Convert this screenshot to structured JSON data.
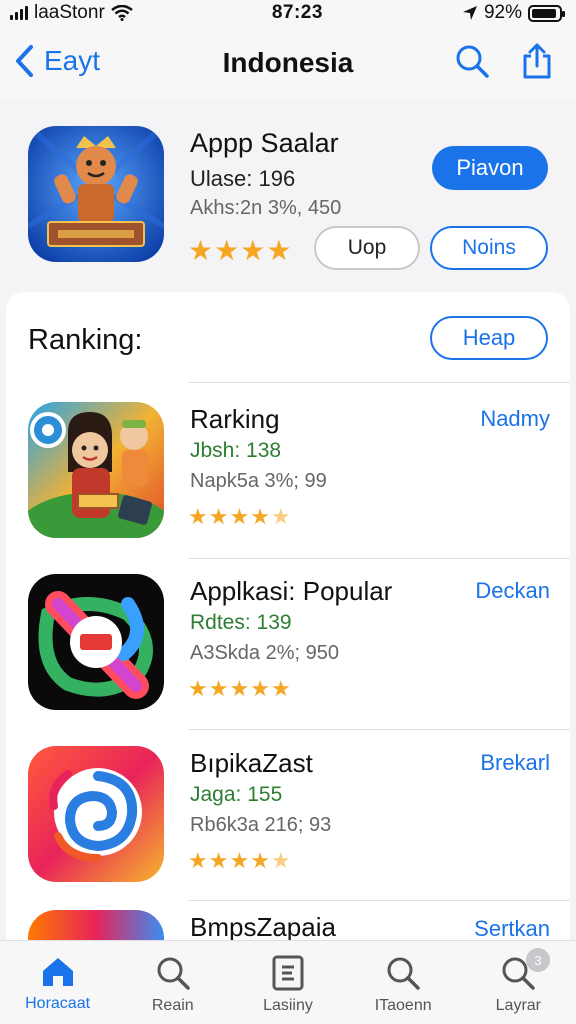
{
  "status_bar": {
    "carrier": "laaStonr",
    "time": "87:23",
    "battery_pct": "92%",
    "battery_level": 0.92
  },
  "nav": {
    "back_label": "Eayt",
    "title": "Indonesia",
    "icons": [
      "search-icon",
      "share-icon"
    ]
  },
  "featured": {
    "name": "Appp Saalar",
    "sub1": "Ulase: 196",
    "sub2": "Akhs:2n 3%, 450",
    "rating": 4,
    "primary_button": "Piavon",
    "button_left": "Uop",
    "button_right": "Noins"
  },
  "ranking": {
    "title": "Ranking:",
    "button": "Heap",
    "items": [
      {
        "name": "Rarking",
        "sub1": "Jbsh: 138",
        "sub2": "Napk5a 3%; 99",
        "rating": 4.5,
        "action": "Nadmy",
        "icon": "game-character-icon"
      },
      {
        "name": "Applkasi: Popular",
        "sub1": "Rdtes: 139",
        "sub2": "A3Skda 2%; 950",
        "rating": 5,
        "action": "Deckan",
        "icon": "neon-app-icon"
      },
      {
        "name": "BıpikaZast",
        "sub1": "Jaga: 155",
        "sub2": "Rb6k3a 216; 93",
        "rating": 4.5,
        "action": "Brekarl",
        "icon": "swirl-app-icon"
      },
      {
        "name": "BmpsZapaia",
        "action": "Sertkan",
        "icon": "rainbow-app-icon"
      }
    ]
  },
  "tab_bar": {
    "tabs": [
      {
        "label": "Horacaat",
        "icon": "home-icon",
        "active": true
      },
      {
        "label": "Reain",
        "icon": "search-icon",
        "active": false
      },
      {
        "label": "Lasiiny",
        "icon": "list-icon",
        "active": false
      },
      {
        "label": "ITaoenn",
        "icon": "search-icon",
        "active": false
      },
      {
        "label": "Layrar",
        "icon": "search-icon",
        "active": false
      }
    ],
    "badge": "3"
  },
  "colors": {
    "accent": "#1a73e8",
    "star": "#f5a623",
    "green_text": "#2e7d32"
  }
}
